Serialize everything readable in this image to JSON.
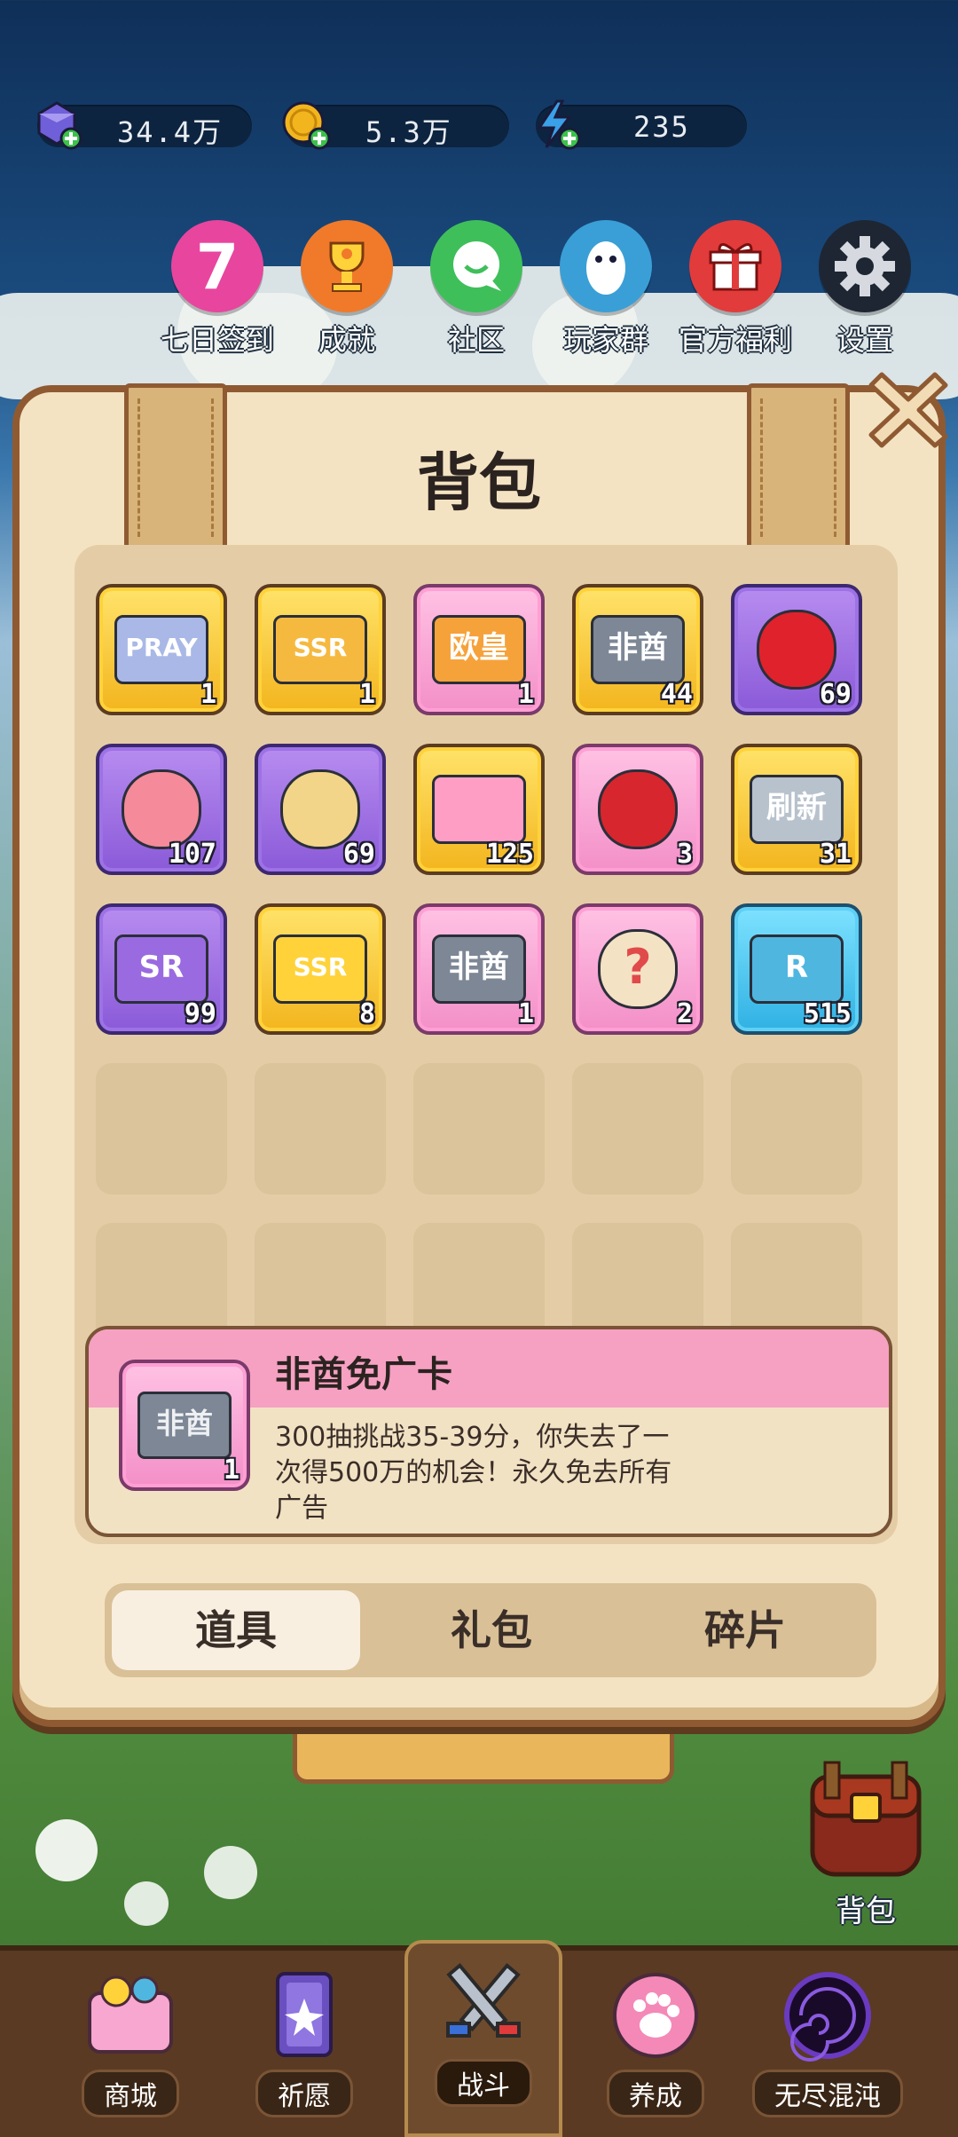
{
  "currencies": [
    {
      "name": "gem",
      "icon": "gem-plus-icon",
      "value": "34.4万"
    },
    {
      "name": "coin",
      "icon": "coin-plus-icon",
      "value": "5.3万"
    },
    {
      "name": "energy",
      "icon": "lightning-plus-icon",
      "value": "235"
    }
  ],
  "top_menu": [
    {
      "id": "signin",
      "label": "七日签到",
      "icon": "seven-icon",
      "color": "#e8459e",
      "glyph": "7"
    },
    {
      "id": "achievement",
      "label": "成就",
      "icon": "trophy-icon",
      "color": "#f07a2a",
      "glyph": "🏆"
    },
    {
      "id": "community",
      "label": "社区",
      "icon": "chat-icon",
      "color": "#3fbf5a",
      "glyph": "💬"
    },
    {
      "id": "players",
      "label": "玩家群",
      "icon": "qq-icon",
      "color": "#3a9fd6",
      "glyph": ""
    },
    {
      "id": "welfare",
      "label": "官方福利",
      "icon": "gift-icon",
      "color": "#e23b3b",
      "glyph": "🎁"
    },
    {
      "id": "settings",
      "label": "设置",
      "icon": "gear-icon",
      "color": "#3b3f48",
      "glyph": "⚙"
    }
  ],
  "modal": {
    "title": "背包",
    "items": [
      {
        "id": "pray-ticket",
        "icon": "pray-ticket-icon",
        "rarity": "gold",
        "count": "1",
        "art_text": "PRAY",
        "art_bg": "#a9b8e6"
      },
      {
        "id": "ssr-ticket",
        "icon": "ssr-ticket-icon",
        "rarity": "gold",
        "count": "1",
        "art_text": "SSR",
        "art_bg": "#f6b940"
      },
      {
        "id": "ouhuang-card",
        "icon": "ouhuang-card-icon",
        "rarity": "pink",
        "count": "1",
        "art_text": "欧皇",
        "art_bg": "#f6a23a"
      },
      {
        "id": "feiqiu-shard",
        "icon": "feiqiu-broken-card-icon",
        "rarity": "gold",
        "count": "44",
        "art_text": "非酋",
        "art_bg": "#7d8796"
      },
      {
        "id": "apple",
        "icon": "apple-icon",
        "rarity": "purple",
        "count": "69",
        "art_text": "",
        "art_bg": "#e0222c"
      },
      {
        "id": "cake",
        "icon": "cake-icon",
        "rarity": "purple",
        "count": "107",
        "art_text": "",
        "art_bg": "#f48a9a"
      },
      {
        "id": "chips",
        "icon": "chips-icon",
        "rarity": "purple",
        "count": "69",
        "art_text": "",
        "art_bg": "#f2d589"
      },
      {
        "id": "pink-ticket",
        "icon": "pink-ticket-icon",
        "rarity": "gold",
        "count": "125",
        "art_text": "",
        "art_bg": "#ff9ec4"
      },
      {
        "id": "plum-flower",
        "icon": "plum-flower-icon",
        "rarity": "pink",
        "count": "3",
        "art_text": "",
        "art_bg": "#d8262e"
      },
      {
        "id": "refresh-card",
        "icon": "refresh-card-icon",
        "rarity": "gold",
        "count": "31",
        "art_text": "刷新",
        "art_bg": "#b8c2cc"
      },
      {
        "id": "sr-fragment",
        "icon": "sr-puzzle-icon",
        "rarity": "purple",
        "count": "99",
        "art_text": "SR",
        "art_bg": "#9a6ae0"
      },
      {
        "id": "ssr-fragment",
        "icon": "ssr-puzzle-icon",
        "rarity": "gold",
        "count": "8",
        "art_text": "SSR",
        "art_bg": "#ffd23a"
      },
      {
        "id": "feiqiu-card",
        "icon": "feiqiu-card-icon",
        "rarity": "pink",
        "count": "1",
        "art_text": "非酋",
        "art_bg": "#7d8796"
      },
      {
        "id": "mystery-bag",
        "icon": "question-bag-icon",
        "rarity": "pink",
        "count": "2",
        "art_text": "?",
        "art_bg": "#f4e2c4"
      },
      {
        "id": "r-fragment",
        "icon": "r-puzzle-icon",
        "rarity": "blue",
        "count": "515",
        "art_text": "R",
        "art_bg": "#4fb6e0"
      }
    ],
    "selected": {
      "name": "非酋免广卡",
      "count": "1",
      "art_text": "非酋",
      "description": "300抽挑战35-39分，你失去了一次得500万的机会！永久免去所有广告"
    },
    "tabs": [
      {
        "label": "道具",
        "active": true
      },
      {
        "label": "礼包",
        "active": false
      },
      {
        "label": "碎片",
        "active": false
      }
    ]
  },
  "side_bag_label": "背包",
  "bottom_nav": [
    {
      "label": "商城",
      "icon": "shop-icon",
      "active": false
    },
    {
      "label": "祈愿",
      "icon": "wish-card-icon",
      "active": false
    },
    {
      "label": "战斗",
      "icon": "crossed-swords-icon",
      "active": true
    },
    {
      "label": "养成",
      "icon": "paw-icon",
      "active": false
    },
    {
      "label": "无尽混沌",
      "icon": "vortex-icon",
      "active": false
    }
  ]
}
